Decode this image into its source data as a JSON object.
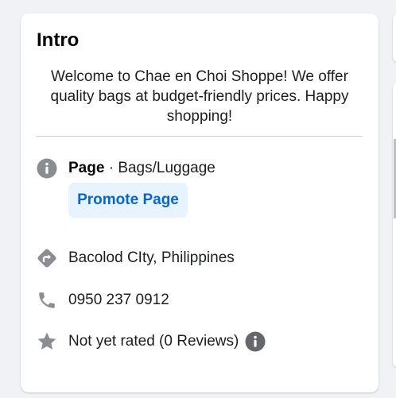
{
  "intro": {
    "title": "Intro",
    "bio": "Welcome to Chae en Choi Shoppe! We offer quality bags at budget-friendly prices. Happy shopping!",
    "page_label": "Page",
    "separator": " · ",
    "category": "Bags/Luggage",
    "promote_label": "Promote Page",
    "location": "Bacolod CIty, Philippines",
    "phone": "0950 237 0912",
    "rating": "Not yet rated (0 Reviews)"
  },
  "colors": {
    "icon_gray": "#8a8d91",
    "accent_blue": "#0866c6",
    "button_bg": "#e7f3ff"
  },
  "icons": {
    "category": "info-icon",
    "location": "directions-icon",
    "phone": "phone-icon",
    "rating": "star-icon",
    "rating_info": "info-icon"
  }
}
